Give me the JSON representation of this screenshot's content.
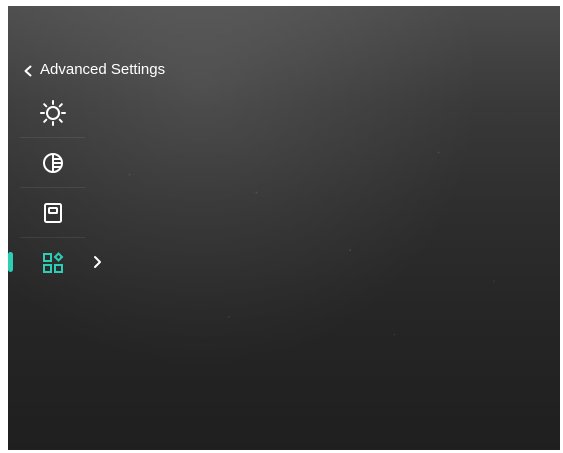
{
  "menu": {
    "back_label": "Advanced Settings",
    "items": [
      {
        "key": "brightness",
        "icon": "sun-icon"
      },
      {
        "key": "contrast",
        "icon": "contrast-icon"
      },
      {
        "key": "display",
        "icon": "screen-icon"
      },
      {
        "key": "more",
        "icon": "function-grid-icon",
        "active": true
      }
    ]
  },
  "colors": {
    "active_accent": "#2ccfb6",
    "icon_default": "#ffffff"
  }
}
